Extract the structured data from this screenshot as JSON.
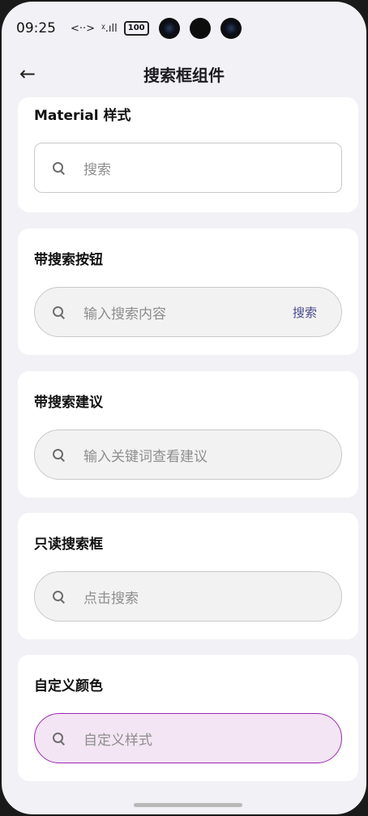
{
  "status": {
    "time": "09:25",
    "signal": "<··>",
    "net": "ᵡ.ıll",
    "battery": "100"
  },
  "header": {
    "title": "搜索框组件",
    "back_icon": "arrow-left-icon"
  },
  "cards": [
    {
      "title": "Material 样式",
      "placeholder": "搜索"
    },
    {
      "title": "带搜索按钮",
      "placeholder": "输入搜索内容",
      "button": "搜索"
    },
    {
      "title": "带搜索建议",
      "placeholder": "输入关键词查看建议"
    },
    {
      "title": "只读搜索框",
      "placeholder": "点击搜索"
    },
    {
      "title": "自定义颜色",
      "placeholder": "自定义样式"
    }
  ],
  "colors": {
    "accent": "#9c27b0",
    "custom_fill": "#f3e5f4",
    "button_text": "#4a4a8a"
  }
}
